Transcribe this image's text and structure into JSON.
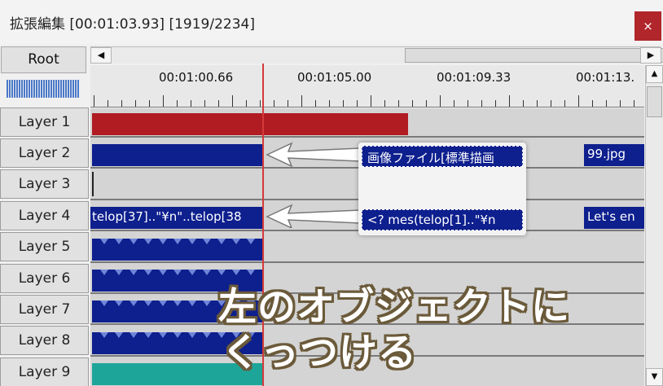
{
  "window": {
    "title": "拡張編集 [00:01:03.93] [1919/2234]",
    "close_label": "×"
  },
  "root_label": "Root",
  "hscroll": {
    "left_arrow": "◀",
    "right_arrow": "▶"
  },
  "vscroll": {
    "up_arrow": "▲",
    "down_arrow": "▼"
  },
  "ruler": {
    "labels": [
      "00:01:00.66",
      "00:01:05.00",
      "00:01:09.33",
      "00:01:13."
    ]
  },
  "layers": [
    "Layer 1",
    "Layer 2",
    "Layer 3",
    "Layer 4",
    "Layer 5",
    "Layer 6",
    "Layer 7",
    "Layer 8",
    "Layer 9"
  ],
  "clips": {
    "layer2_right": "99.jpg",
    "layer4_left": "telop[37]..\"¥n\"..telop[38",
    "layer4_right": "Let's en"
  },
  "overlay": {
    "image_clip": "画像ファイル[標準描画",
    "text_clip": "<? mes(telop[1]..\"¥n"
  },
  "caption": {
    "line1": "左のオブジェクトに",
    "line2": "くっつける"
  },
  "colors": {
    "red_clip": "#b01c22",
    "blue_clip": "#0e1f8e",
    "teal_clip": "#1ea59a",
    "cursor": "#d43a3a"
  }
}
